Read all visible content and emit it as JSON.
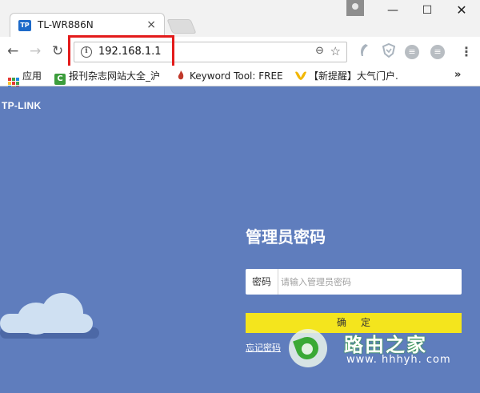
{
  "browser": {
    "tab": {
      "favicon_text": "TP",
      "title": "TL-WR886N",
      "close_glyph": "×"
    },
    "window_controls": {
      "minimize": "—",
      "maximize": "☐",
      "close": "✕"
    },
    "nav": {
      "back": "←",
      "forward": "→",
      "reload": "↻"
    },
    "address": {
      "info_glyph": "i",
      "url": "192.168.1.1",
      "zoom_glyph": "⊖",
      "star_glyph": "☆"
    },
    "extensions": [
      "feather-icon",
      "shield-icon",
      "circle-ext-icon",
      "circle-ext-icon"
    ],
    "menu_glyph": "⋮",
    "bookmarks": [
      {
        "label": "应用",
        "icon": "apps-grid-icon"
      },
      {
        "label": "报刊杂志网站大全_沪",
        "icon": "green-c-icon"
      },
      {
        "label": "Keyword Tool: FREE",
        "icon": "flame-icon"
      },
      {
        "label": "【新提醒】大气门户.",
        "icon": "yellow-icon"
      }
    ],
    "bookmarks_more": "»"
  },
  "page": {
    "brand": "TP-LINK",
    "login": {
      "title": "管理员密码",
      "password_label": "密码",
      "password_placeholder": "请输入管理员密码",
      "password_value": "",
      "confirm_label": "确定",
      "forgot_link": "忘记密码"
    },
    "watermark": {
      "name": "路由之家",
      "url": "www. hhhyh. com"
    }
  },
  "colors": {
    "page_bg": "#5f7dbd",
    "confirm_button": "#f4e51d",
    "highlight": "#e31b1b",
    "watermark_green": "#3aa935"
  }
}
